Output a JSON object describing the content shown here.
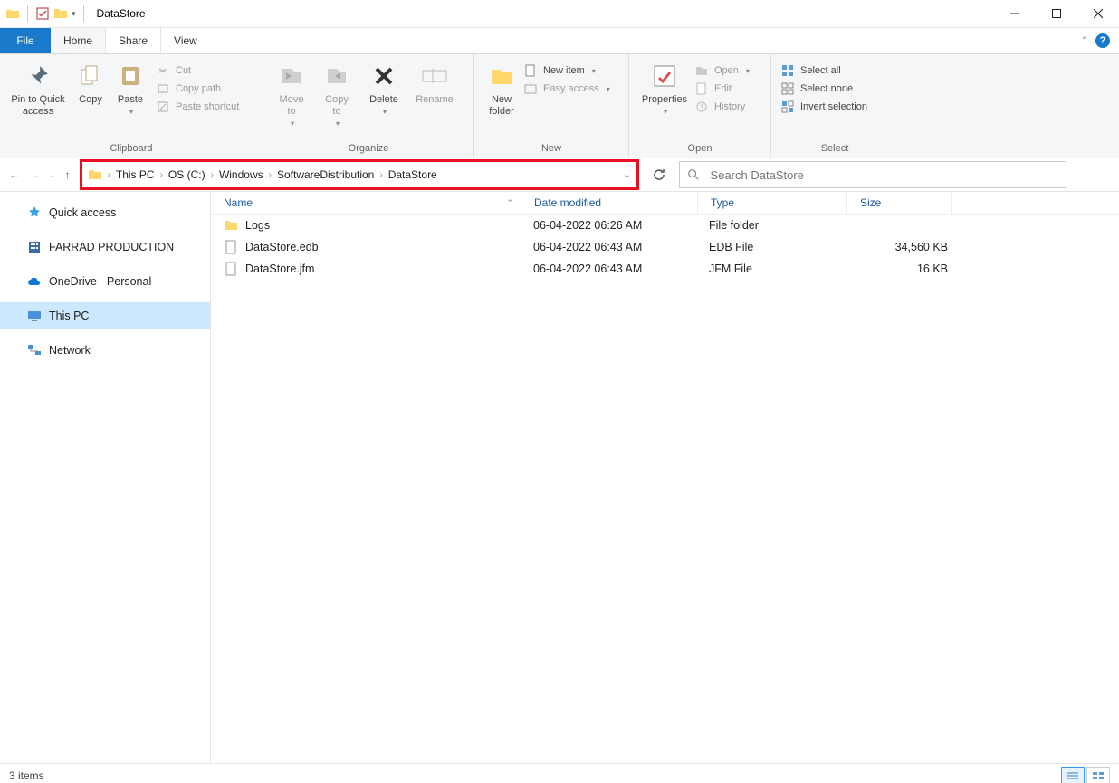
{
  "title": "DataStore",
  "tabs": {
    "file": "File",
    "home": "Home",
    "share": "Share",
    "view": "View"
  },
  "ribbon": {
    "clipboard": {
      "label": "Clipboard",
      "pin": "Pin to Quick\naccess",
      "copy": "Copy",
      "paste": "Paste",
      "cut": "Cut",
      "copy_path": "Copy path",
      "paste_shortcut": "Paste shortcut"
    },
    "organize": {
      "label": "Organize",
      "move_to": "Move\nto",
      "copy_to": "Copy\nto",
      "delete": "Delete",
      "rename": "Rename"
    },
    "new": {
      "label": "New",
      "new_folder": "New\nfolder",
      "new_item": "New item",
      "easy_access": "Easy access"
    },
    "open": {
      "label": "Open",
      "properties": "Properties",
      "open": "Open",
      "edit": "Edit",
      "history": "History"
    },
    "select": {
      "label": "Select",
      "select_all": "Select all",
      "select_none": "Select none",
      "invert": "Invert selection"
    }
  },
  "breadcrumbs": [
    "This PC",
    "OS (C:)",
    "Windows",
    "SoftwareDistribution",
    "DataStore"
  ],
  "search_placeholder": "Search DataStore",
  "sidebar": {
    "quick_access": "Quick access",
    "farrad": "FARRAD PRODUCTION",
    "onedrive": "OneDrive - Personal",
    "this_pc": "This PC",
    "network": "Network"
  },
  "columns": {
    "name": "Name",
    "date": "Date modified",
    "type": "Type",
    "size": "Size"
  },
  "rows": [
    {
      "name": "Logs",
      "icon": "folder",
      "date": "06-04-2022 06:26 AM",
      "type": "File folder",
      "size": ""
    },
    {
      "name": "DataStore.edb",
      "icon": "file",
      "date": "06-04-2022 06:43 AM",
      "type": "EDB File",
      "size": "34,560 KB"
    },
    {
      "name": "DataStore.jfm",
      "icon": "file",
      "date": "06-04-2022 06:43 AM",
      "type": "JFM File",
      "size": "16 KB"
    }
  ],
  "status": "3 items"
}
